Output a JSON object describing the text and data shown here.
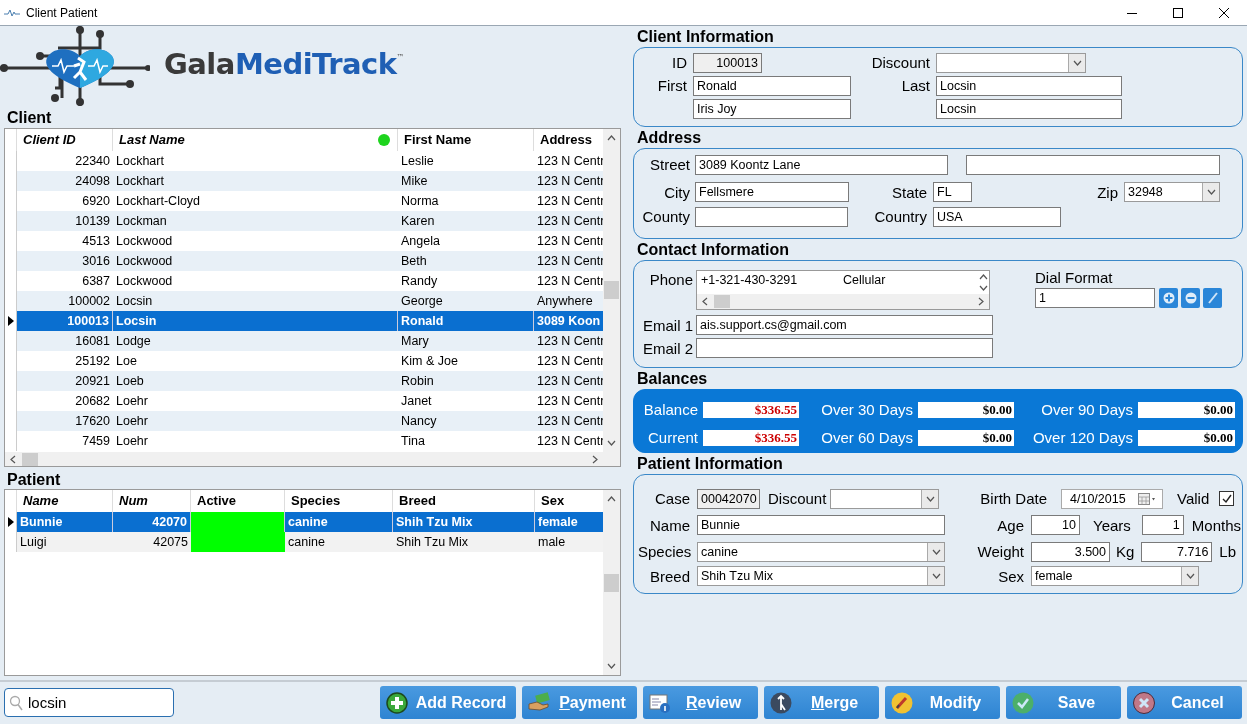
{
  "window": {
    "title": "Client Patient"
  },
  "logo": {
    "brand_first": "Gala",
    "brand_second": "MediTrack",
    "trademark": "™"
  },
  "client": {
    "title": "Client",
    "columns": [
      {
        "label": "Client ID",
        "italic": true
      },
      {
        "label": "Last Name",
        "italic": true
      },
      {
        "label": "First Name",
        "italic": false
      },
      {
        "label": "Address",
        "italic": false
      }
    ],
    "rows": [
      {
        "cells": [
          "22340",
          "Lockhart",
          "Leslie",
          "123 N Centr"
        ],
        "selected": false
      },
      {
        "cells": [
          "24098",
          "Lockhart",
          "Mike",
          "123 N Centr"
        ],
        "selected": false
      },
      {
        "cells": [
          "6920",
          "Lockhart-Cloyd",
          "Norma",
          "123 N Centr"
        ],
        "selected": false
      },
      {
        "cells": [
          "10139",
          "Lockman",
          "Karen",
          "123 N Centr"
        ],
        "selected": false
      },
      {
        "cells": [
          "4513",
          "Lockwood",
          "Angela",
          "123 N Centr"
        ],
        "selected": false
      },
      {
        "cells": [
          "3016",
          "Lockwood",
          "Beth",
          "123 N Centr"
        ],
        "selected": false
      },
      {
        "cells": [
          "6387",
          "Lockwood",
          "Randy",
          "123 N Centr"
        ],
        "selected": false
      },
      {
        "cells": [
          "100002",
          "Locsin",
          "George",
          "Anywhere"
        ],
        "selected": false
      },
      {
        "cells": [
          "100013",
          "Locsin",
          "Ronald",
          "3089 Koon"
        ],
        "selected": true
      },
      {
        "cells": [
          "16081",
          "Lodge",
          "Mary",
          "123 N Centr"
        ],
        "selected": false
      },
      {
        "cells": [
          "25192",
          "Loe",
          "Kim & Joe",
          "123 N Centr"
        ],
        "selected": false
      },
      {
        "cells": [
          "20921",
          "Loeb",
          "Robin",
          "123 N Centr"
        ],
        "selected": false
      },
      {
        "cells": [
          "20682",
          "Loehr",
          "Janet",
          "123 N Centr"
        ],
        "selected": false
      },
      {
        "cells": [
          "17620",
          "Loehr",
          "Nancy",
          "123 N Centr"
        ],
        "selected": false
      },
      {
        "cells": [
          "7459",
          "Loehr",
          "Tina",
          "123 N Centr"
        ],
        "selected": false
      }
    ]
  },
  "patient": {
    "title": "Patient",
    "columns": [
      {
        "label": "Name",
        "italic": true
      },
      {
        "label": "Num",
        "italic": true
      },
      {
        "label": "Active",
        "italic": false
      },
      {
        "label": "Species",
        "italic": false
      },
      {
        "label": "Breed",
        "italic": false
      },
      {
        "label": "Sex",
        "italic": false
      }
    ],
    "rows": [
      {
        "name": "Bunnie",
        "num": "42070",
        "active": true,
        "species": "canine",
        "breed": "Shih Tzu Mix",
        "sex": "female",
        "selected": true
      },
      {
        "name": "Luigi",
        "num": "42075",
        "active": true,
        "species": "canine",
        "breed": "Shih Tzu Mix",
        "sex": "male",
        "selected": false
      }
    ]
  },
  "client_information": {
    "title": "Client Information",
    "id_label": "ID",
    "id": "100013",
    "discount_label": "Discount",
    "first_label": "First",
    "first": "Ronald",
    "first_2": "Iris Joy",
    "last_label": "Last",
    "last": "Locsin",
    "last_2": "Locsin"
  },
  "address": {
    "title": "Address",
    "street_label": "Street",
    "street": "3089 Koontz Lane",
    "city_label": "City",
    "city": "Fellsmere",
    "state_label": "State",
    "state": "FL",
    "zip_label": "Zip",
    "zip": "32948",
    "county_label": "County",
    "country_label": "Country",
    "country": "USA"
  },
  "contact_information": {
    "title": "Contact Information",
    "phone_label": "Phone",
    "phone": "+1-321-430-3291",
    "phone_type": "Cellular",
    "email_1_label": "Email 1",
    "email_1": "ais.support.cs@gmail.com",
    "email_2_label": "Email 2",
    "dial_format_label": "Dial Format",
    "dial_format": "1"
  },
  "balances": {
    "title": "Balances",
    "items": [
      {
        "label": "Balance",
        "value": "$336.55",
        "color": "#cc0000"
      },
      {
        "label": "Over 30 Days",
        "value": "$0.00",
        "color": "#000000"
      },
      {
        "label": "Over 90 Days",
        "value": "$0.00",
        "color": "#000000"
      },
      {
        "label": "Current",
        "value": "$336.55",
        "color": "#cc0000"
      },
      {
        "label": "Over 60 Days",
        "value": "$0.00",
        "color": "#000000"
      },
      {
        "label": "Over 120 Days",
        "value": "$0.00",
        "color": "#000000"
      }
    ]
  },
  "patient_information": {
    "title": "Patient Information",
    "case_label": "Case",
    "case": "00042070",
    "discount_label": "Discount",
    "name_label": "Name",
    "name": "Bunnie",
    "species_label": "Species",
    "species": "canine",
    "breed_label": "Breed",
    "breed": "Shih Tzu Mix",
    "birth_date_label": "Birth Date",
    "birth_date": "4/10/2015",
    "valid": {
      "label": "Valid",
      "checked": true
    },
    "age_label": "Age",
    "age_years": "10",
    "years_label": "Years",
    "age_months": "1",
    "months_label": "Months",
    "weight_label": "Weight",
    "weight_kg": "3.500",
    "kg_label": "Kg",
    "weight_lb": "7.716",
    "lb_label": "Lb",
    "sex_label": "Sex",
    "sex": "female"
  },
  "search": {
    "value": "locsin"
  },
  "buttons": [
    {
      "label": "Add Record",
      "kind": "add",
      "access_key": false
    },
    {
      "label": "Payment",
      "kind": "payment",
      "access_key": true
    },
    {
      "label": "Review",
      "kind": "review",
      "access_key": true
    },
    {
      "label": "Merge",
      "kind": "merge",
      "access_key": true
    },
    {
      "label": "Modify",
      "kind": "modify",
      "access_key": false
    },
    {
      "label": "Save",
      "kind": "save",
      "access_key": false
    },
    {
      "label": "Cancel",
      "kind": "cancel",
      "access_key": false
    }
  ]
}
